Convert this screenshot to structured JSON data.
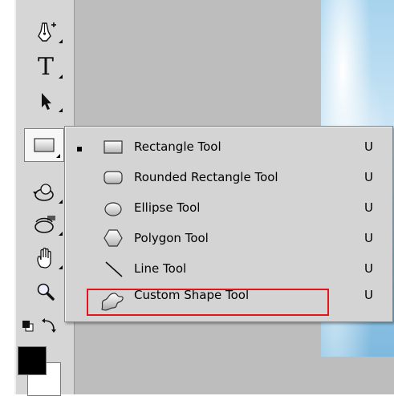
{
  "toolbar": {
    "tools": [
      {
        "name": "pen-tool-icon"
      },
      {
        "name": "type-tool-icon",
        "glyph": "T"
      },
      {
        "name": "path-selection-tool-icon"
      },
      {
        "name": "rectangle-tool-icon",
        "selected": true
      },
      {
        "name": "3d-rotate-tool-icon"
      },
      {
        "name": "3d-orbit-tool-icon"
      },
      {
        "name": "hand-tool-icon"
      },
      {
        "name": "zoom-tool-icon"
      }
    ],
    "swatches": {
      "foreground": "#000000",
      "background": "#ffffff"
    }
  },
  "flyout_menu": {
    "items": [
      {
        "label": "Rectangle Tool",
        "shortcut": "U",
        "icon": "rectangle-icon",
        "active": true
      },
      {
        "label": "Rounded Rectangle Tool",
        "shortcut": "U",
        "icon": "rounded-rectangle-icon",
        "active": false
      },
      {
        "label": "Ellipse Tool",
        "shortcut": "U",
        "icon": "ellipse-icon",
        "active": false
      },
      {
        "label": "Polygon Tool",
        "shortcut": "U",
        "icon": "polygon-icon",
        "active": false
      },
      {
        "label": "Line Tool",
        "shortcut": "U",
        "icon": "line-icon",
        "active": false
      },
      {
        "label": "Custom Shape Tool",
        "shortcut": "U",
        "icon": "custom-shape-icon",
        "active": false
      }
    ],
    "highlighted_item": "Custom Shape Tool",
    "highlight_color": "#e0141a"
  }
}
